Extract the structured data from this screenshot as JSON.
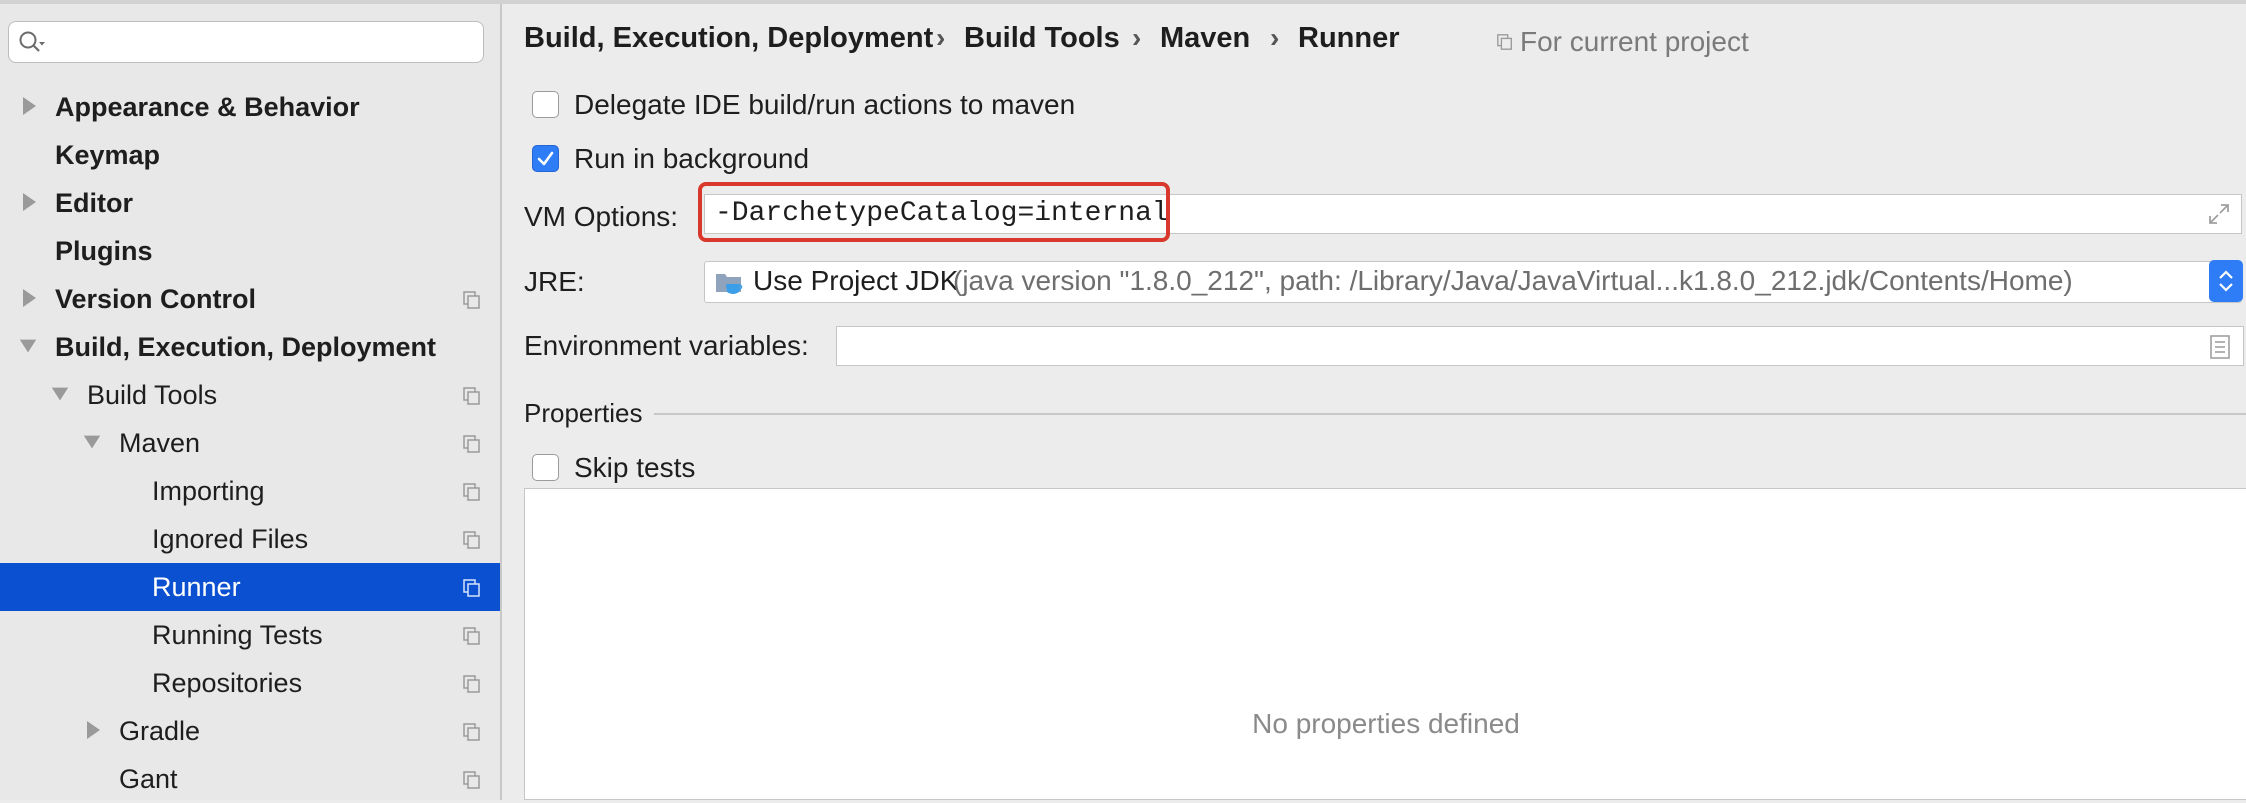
{
  "sidebar": {
    "search": {
      "placeholder": ""
    },
    "items": [
      {
        "label": "Appearance & Behavior"
      },
      {
        "label": "Keymap"
      },
      {
        "label": "Editor"
      },
      {
        "label": "Plugins"
      },
      {
        "label": "Version Control"
      },
      {
        "label": "Build, Execution, Deployment"
      },
      {
        "label": "Build Tools"
      },
      {
        "label": "Maven"
      },
      {
        "label": "Importing"
      },
      {
        "label": "Ignored Files"
      },
      {
        "label": "Runner"
      },
      {
        "label": "Running Tests"
      },
      {
        "label": "Repositories"
      },
      {
        "label": "Gradle"
      },
      {
        "label": "Gant"
      }
    ],
    "selected_color": "#0b50d0"
  },
  "header": {
    "breadcrumb": [
      "Build, Execution, Deployment",
      "Build Tools",
      "Maven",
      "Runner"
    ],
    "separator": "›",
    "scope": "For current project"
  },
  "runner": {
    "delegate": {
      "label": "Delegate IDE build/run actions to maven",
      "checked": false
    },
    "background": {
      "label": "Run in background",
      "checked": true
    },
    "vm_options": {
      "label": "VM Options:",
      "value": "-DarchetypeCatalog=internal"
    },
    "jre": {
      "label": "JRE:",
      "selected": "Use Project JDK",
      "detail": "(java version \"1.8.0_212\", path: /Library/Java/JavaVirtual...k1.8.0_212.jdk/Contents/Home)"
    },
    "env": {
      "label": "Environment variables:",
      "value": ""
    },
    "properties": {
      "title": "Properties",
      "skip_tests": {
        "label": "Skip tests",
        "checked": false
      },
      "empty_text": "No properties defined"
    }
  },
  "colors": {
    "accent": "#2e7cf6",
    "highlight_box": "#d9382c"
  }
}
